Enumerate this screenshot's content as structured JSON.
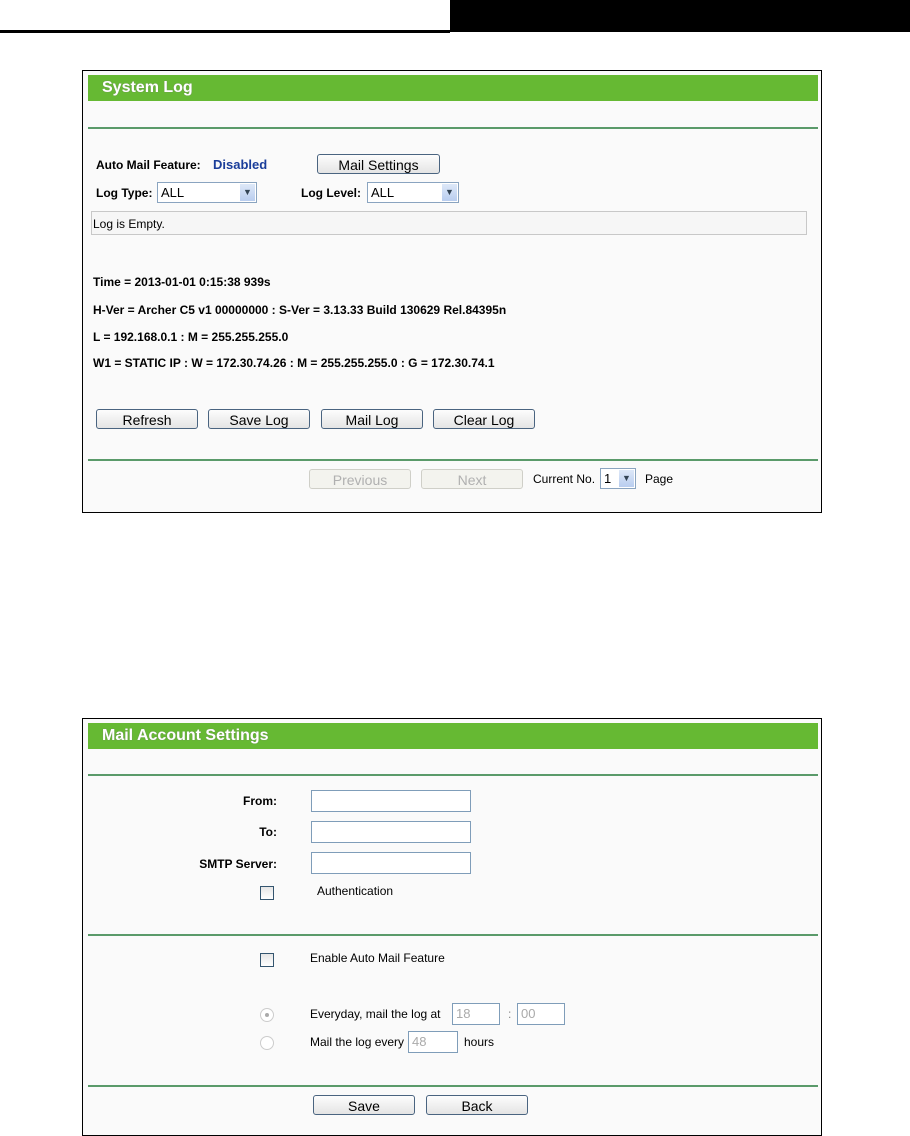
{
  "system_log": {
    "title": "System Log",
    "auto_mail_label": "Auto Mail Feature:",
    "auto_mail_status": "Disabled",
    "mail_settings_button": "Mail Settings",
    "log_type_label": "Log Type:",
    "log_type_value": "ALL",
    "log_level_label": "Log Level:",
    "log_level_value": "ALL",
    "log_content": "Log is Empty.",
    "info_lines": [
      "Time = 2013-01-01 0:15:38 939s",
      "H-Ver = Archer C5 v1 00000000 : S-Ver = 3.13.33 Build 130629 Rel.84395n",
      "L = 192.168.0.1 : M = 255.255.255.0",
      "W1 = STATIC IP : W = 172.30.74.26 : M = 255.255.255.0 : G = 172.30.74.1"
    ],
    "buttons": {
      "refresh": "Refresh",
      "save_log": "Save Log",
      "mail_log": "Mail Log",
      "clear_log": "Clear Log"
    },
    "pager": {
      "previous": "Previous",
      "next": "Next",
      "current_label": "Current No.",
      "current_value": "1",
      "page_label": "Page"
    }
  },
  "mail_settings": {
    "title": "Mail Account Settings",
    "from_label": "From:",
    "from_value": "",
    "to_label": "To:",
    "to_value": "",
    "smtp_label": "SMTP Server:",
    "smtp_value": "",
    "authentication_label": "Authentication",
    "enable_auto_mail_label": "Enable Auto Mail Feature",
    "everyday_label": "Everyday, mail the log at",
    "hour_value": "18",
    "colon": ":",
    "minute_value": "00",
    "every_label": "Mail the log every",
    "every_value": "48",
    "hours_label": "hours",
    "save_button": "Save",
    "back_button": "Back"
  }
}
